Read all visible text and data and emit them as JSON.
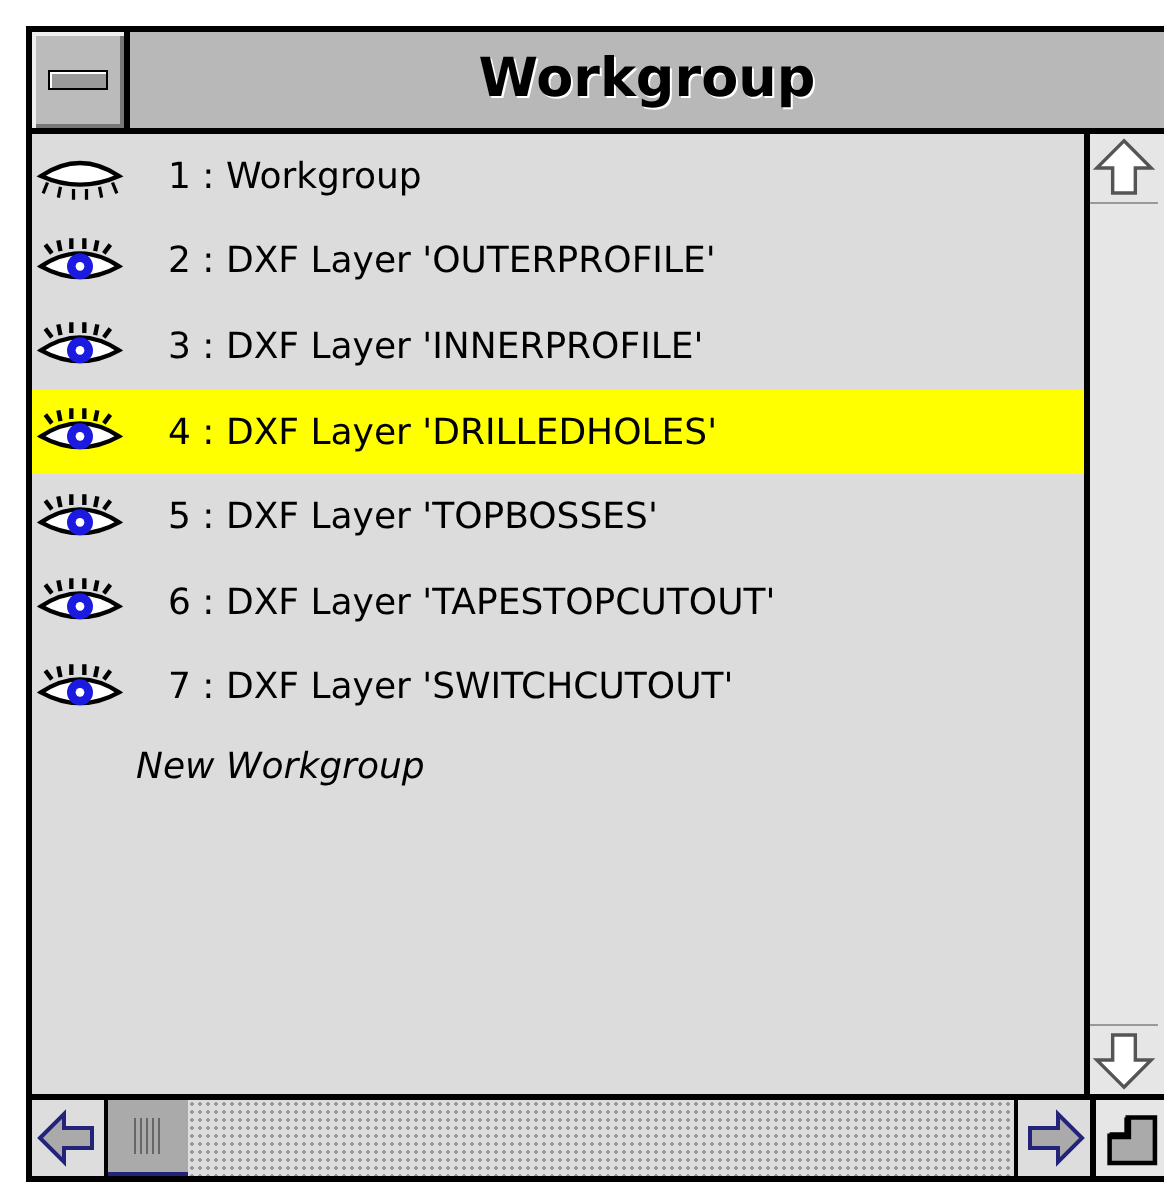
{
  "window": {
    "title": "Workgroup"
  },
  "layers": [
    {
      "label": "1 : Workgroup",
      "visible": false,
      "selected": false
    },
    {
      "label": "2 : DXF Layer 'OUTERPROFILE'",
      "visible": true,
      "selected": false
    },
    {
      "label": "3 : DXF Layer 'INNERPROFILE'",
      "visible": true,
      "selected": false
    },
    {
      "label": "4 : DXF Layer 'DRILLEDHOLES'",
      "visible": true,
      "selected": true
    },
    {
      "label": "5 : DXF Layer 'TOPBOSSES'",
      "visible": true,
      "selected": false
    },
    {
      "label": "6 : DXF Layer 'TAPESTOPCUTOUT'",
      "visible": true,
      "selected": false
    },
    {
      "label": "7 : DXF Layer 'SWITCHCUTOUT'",
      "visible": true,
      "selected": false
    }
  ],
  "new_item": {
    "label": "New Workgroup"
  }
}
